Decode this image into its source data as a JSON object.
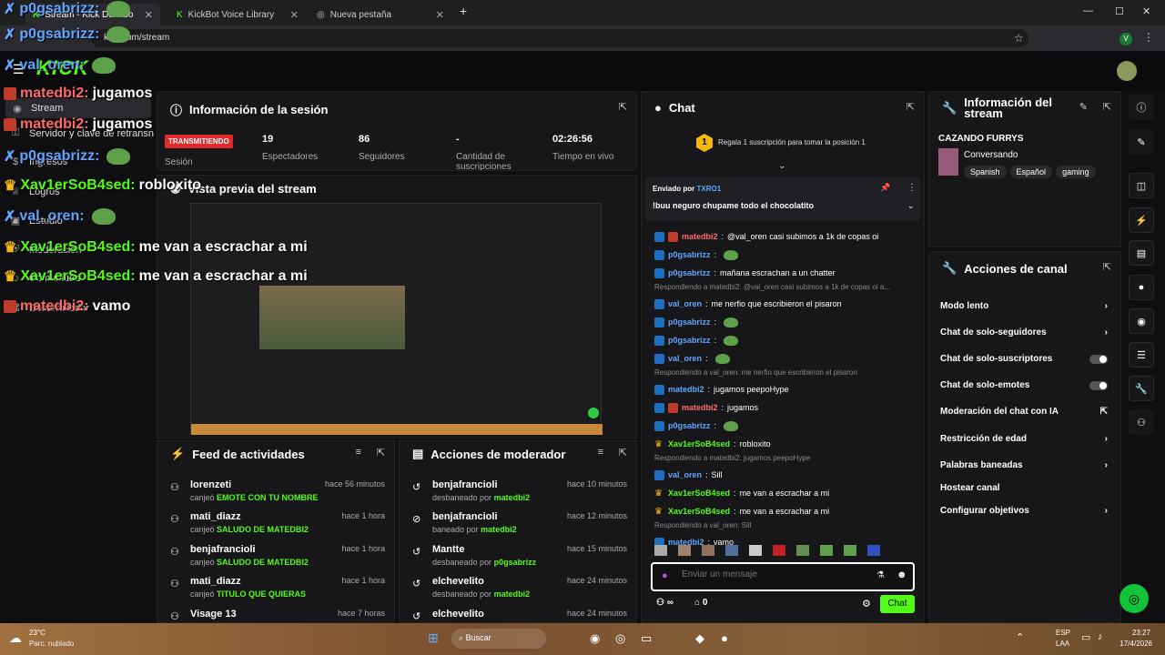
{
  "browser": {
    "tabs": [
      {
        "label": "Stream - Kick Dashbo",
        "active": true
      },
      {
        "label": "KickBot Voice Library",
        "active": false
      },
      {
        "label": "Nueva pestaña",
        "active": false
      }
    ],
    "url": "kick.com/stream",
    "profile_initial": "V"
  },
  "kick": {
    "logo": "KICK"
  },
  "sidebar": {
    "items": [
      {
        "label": "Stream",
        "icon": "broadcast-icon"
      },
      {
        "label": "Servidor y clave de retransn",
        "icon": "key-icon"
      },
      {
        "label": "Ingresos",
        "icon": "money-icon"
      },
      {
        "label": "Logros",
        "icon": "trophy-icon"
      },
      {
        "label": "Estudio",
        "icon": "studio-icon"
      },
      {
        "label": "Moderación",
        "icon": "shield-icon"
      },
      {
        "label": "Comunidad",
        "icon": "users-icon"
      },
      {
        "label": "Desarrollador",
        "icon": "code-icon"
      }
    ]
  },
  "session": {
    "title": "Información de la sesión",
    "status": "TRANSMITIENDO",
    "status_label": "Sesión",
    "stats": [
      {
        "value": "19",
        "label": "Espectadores"
      },
      {
        "value": "86",
        "label": "Seguidores"
      },
      {
        "value": "-",
        "label": "Cantidad de suscripciones"
      },
      {
        "value": "02:26:56",
        "label": "Tiempo en vivo"
      }
    ]
  },
  "preview": {
    "title": "Vista previa del stream"
  },
  "activity": {
    "title": "Feed de actividades",
    "items": [
      {
        "name": "lorenzeti",
        "action": "canjeó",
        "reward": "EMOTE CON TU NOMBRE",
        "time": "hace 56 minutos"
      },
      {
        "name": "mati_diazz",
        "action": "canjeó",
        "reward": "SALUDO DE MATEDBI2",
        "time": "hace 1 hora"
      },
      {
        "name": "benjafrancioli",
        "action": "canjeó",
        "reward": "SALUDO DE MATEDBI2",
        "time": "hace 1 hora"
      },
      {
        "name": "mati_diazz",
        "action": "canjeó",
        "reward": "TITULO QUE QUIERAS",
        "time": "hace 1 hora"
      },
      {
        "name": "Visage 13",
        "action": "",
        "reward": "",
        "time": "hace 7 horas"
      }
    ]
  },
  "modactions": {
    "title": "Acciones de moderador",
    "items": [
      {
        "name": "benjafrancioli",
        "action": "desbaneado por",
        "by": "matedbi2",
        "time": "hace 10 minutos"
      },
      {
        "name": "benjafrancioli",
        "action": "baneado por",
        "by": "matedbi2",
        "time": "hace 12 minutos"
      },
      {
        "name": "Mantte",
        "action": "desbaneado por",
        "by": "p0gsabrizz",
        "time": "hace 15 minutos"
      },
      {
        "name": "elchevelito",
        "action": "desbaneado por",
        "by": "matedbi2",
        "time": "hace 24 minutos"
      },
      {
        "name": "elchevelito",
        "action": "",
        "by": "",
        "time": "hace 24 minutos"
      }
    ]
  },
  "chat": {
    "title": "Chat",
    "gift_rank": "1",
    "gift_text": "Regala 1 suscripción para tomar la posición 1",
    "pinned": {
      "label": "Enviado por",
      "user": "TXRO1",
      "message": "!buu neguro chupame todo el chocolatito"
    },
    "messages": [
      {
        "user": "matedbi2",
        "color": "#ff6b6b",
        "text": "@val_oren casi subimos a 1k de copas oi",
        "badge": "owner"
      },
      {
        "user": "p0gsabrizz",
        "color": "#60a5ff",
        "text": "",
        "badge": "mod"
      },
      {
        "user": "p0gsabrizz",
        "color": "#60a5ff",
        "text": "mañana escrachan a un chatter",
        "badge": "mod"
      },
      {
        "reply": "Respondiendo a matedbi2: @val_oren casi subimos a 1k de copas oi a..."
      },
      {
        "user": "val_oren",
        "color": "#60a5ff",
        "text": "me nerfio que escribieron el pisaron",
        "badge": "mod"
      },
      {
        "user": "p0gsabrizz",
        "color": "#60a5ff",
        "text": "",
        "badge": "mod"
      },
      {
        "user": "p0gsabrizz",
        "color": "#60a5ff",
        "text": "",
        "badge": "mod"
      },
      {
        "user": "val_oren",
        "color": "#60a5ff",
        "text": "",
        "badge": "mod"
      },
      {
        "reply": "Respondiendo a val_oren: me nerfio que escribieron el pisaron"
      },
      {
        "user": "matedbi2",
        "color": "#60a5ff",
        "text": "jugamos peepoHype",
        "badge": "mod"
      },
      {
        "user": "matedbi2",
        "color": "#ff6b6b",
        "text": "jugamos",
        "badge": "owner"
      },
      {
        "user": "p0gsabrizz",
        "color": "#60a5ff",
        "text": "",
        "badge": "mod"
      },
      {
        "user": "Xav1erSoB4sed",
        "color": "#53fc18",
        "text": "robloxito",
        "badge": "crown"
      },
      {
        "reply": "Respondiendo a matedbi2: jugamos peepoHype"
      },
      {
        "user": "val_oren",
        "color": "#60a5ff",
        "text": "Sill",
        "badge": "mod"
      },
      {
        "user": "Xav1erSoB4sed",
        "color": "#53fc18",
        "text": "me van a escrachar a mi",
        "badge": "crown"
      },
      {
        "user": "Xav1erSoB4sed",
        "color": "#53fc18",
        "text": "me van a escrachar a mi",
        "badge": "crown"
      },
      {
        "reply": "Respondiendo a val_oren: Sill"
      },
      {
        "user": "matedbi2",
        "color": "#60a5ff",
        "text": "vamo",
        "badge": "mod"
      }
    ],
    "input_placeholder": "Enviar un mensaje",
    "send_label": "Chat",
    "points": "∞",
    "gifts": "0"
  },
  "stream_info": {
    "title": "Información del stream",
    "stream_title": "CAZANDO FURRYS",
    "category": "Conversando",
    "tags": [
      "Spanish",
      "Español",
      "gaming"
    ]
  },
  "channel_actions": {
    "title": "Acciones de canal",
    "items": [
      {
        "label": "Modo lento",
        "control": "arrow"
      },
      {
        "label": "Chat de solo-seguidores",
        "control": "arrow"
      },
      {
        "label": "Chat de solo-suscriptores",
        "control": "toggle"
      },
      {
        "label": "Chat de solo-emotes",
        "control": "toggle"
      },
      {
        "label": "Moderación del chat con IA",
        "control": "external"
      },
      {
        "label": "Restricción de edad",
        "control": "arrow"
      },
      {
        "label": "Palabras baneadas",
        "control": "arrow"
      },
      {
        "label": "Hostear canal",
        "control": "none"
      },
      {
        "label": "Configurar objetivos",
        "control": "arrow"
      }
    ]
  },
  "overlay": [
    {
      "user": "p0gsabrizz:",
      "text": "",
      "icon": "mod"
    },
    {
      "user": "p0gsabrizz:",
      "text": "",
      "icon": "mod"
    },
    {
      "user": "val_oren:",
      "text": "",
      "icon": "mod"
    },
    {
      "user": "matedbi2:",
      "text": "jugamos",
      "icon": "owner"
    },
    {
      "user": "matedbi2:",
      "text": "jugamos",
      "icon": "owner"
    },
    {
      "user": "p0gsabrizz:",
      "text": "",
      "icon": "mod"
    },
    {
      "user": "Xav1erSoB4sed:",
      "text": "robloxito",
      "icon": "crown"
    },
    {
      "user": "val_oren:",
      "text": "",
      "icon": "mod"
    },
    {
      "user": "Xav1erSoB4sed:",
      "text": "me van a escrachar a mi",
      "icon": "crown"
    },
    {
      "user": "Xav1erSoB4sed:",
      "text": "me van a escrachar a mi",
      "icon": "crown"
    },
    {
      "user": "matedbi2:",
      "text": "vamo",
      "icon": "owner"
    }
  ],
  "taskbar": {
    "temp": "23°C",
    "weather": "Parc. nublado",
    "search": "Buscar",
    "lang": "ESP",
    "layout": "LAA",
    "time": "23:27",
    "date": "17/4/2026"
  }
}
